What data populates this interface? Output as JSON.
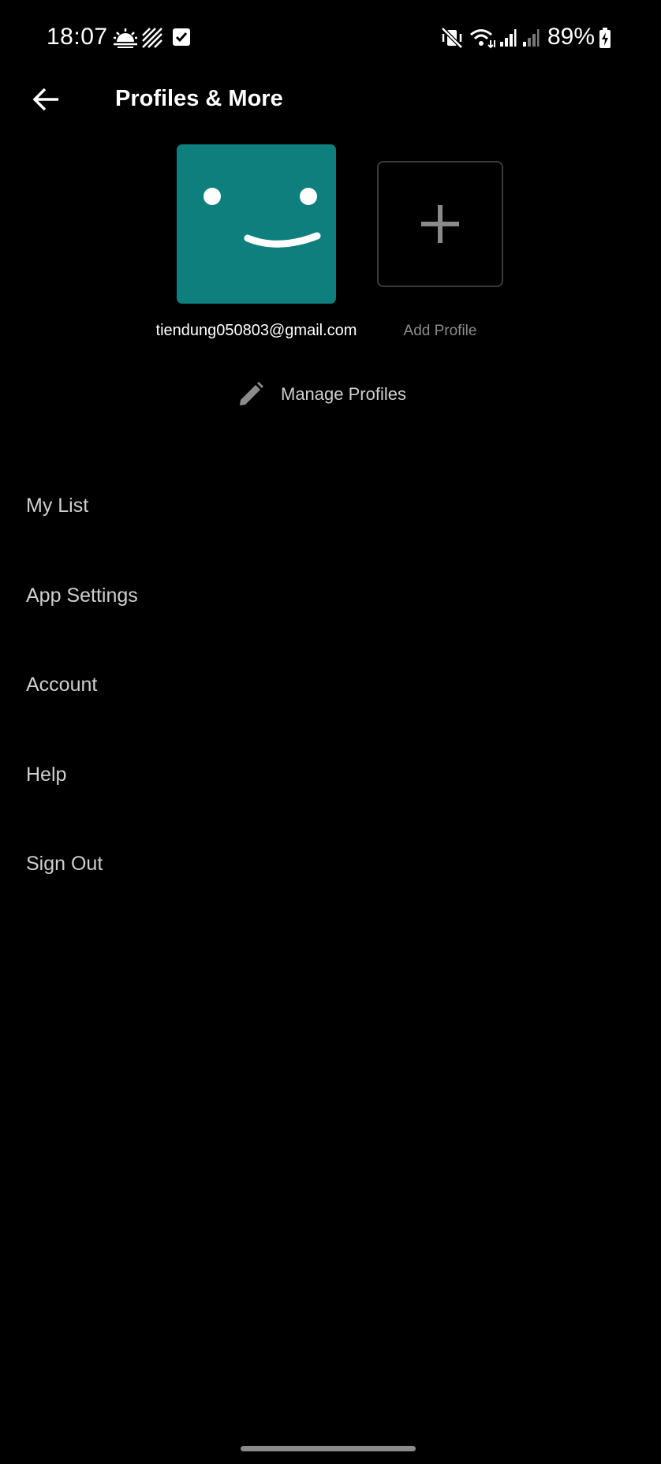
{
  "status_bar": {
    "time": "18:07",
    "battery": "89%",
    "left_icons": [
      "sunrise-icon",
      "hatched-square-icon",
      "checkbox-icon"
    ],
    "right_icons": [
      "vibrate-mute-icon",
      "wifi-icon",
      "signal-icon",
      "signal-icon",
      "battery-charging-icon"
    ]
  },
  "header": {
    "title": "Profiles & More",
    "back_icon": "arrow-left-icon"
  },
  "profiles": {
    "current": {
      "name": "tiendung050803@gmail.com",
      "avatar_color": "#0e7f7c",
      "avatar_icon": "smiley-face-icon"
    },
    "add": {
      "label": "Add Profile",
      "icon": "plus-icon"
    }
  },
  "manage_profiles": {
    "label": "Manage Profiles",
    "icon": "pencil-icon"
  },
  "menu": {
    "items": [
      {
        "label": "My List"
      },
      {
        "label": "App Settings"
      },
      {
        "label": "Account"
      },
      {
        "label": "Help"
      },
      {
        "label": "Sign Out"
      }
    ]
  },
  "colors": {
    "background": "#000000",
    "accent": "#0e7f7c",
    "menu_text": "#cfcfcf",
    "muted_text": "#8c8c8c"
  }
}
